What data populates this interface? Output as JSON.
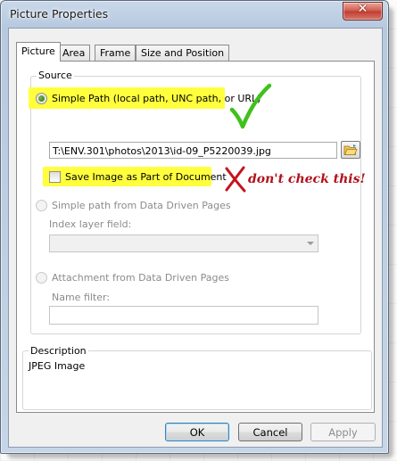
{
  "window": {
    "title": "Picture Properties",
    "close_glyph": "✕"
  },
  "tabs": [
    {
      "label": "Picture",
      "active": true
    },
    {
      "label": "Area",
      "active": false
    },
    {
      "label": "Frame",
      "active": false
    },
    {
      "label": "Size and Position",
      "active": false
    }
  ],
  "source": {
    "group_label": "Source",
    "simple_path_label": "Simple Path (local path, UNC path, or URL)",
    "path_value": "T:\\ENV.301\\photos\\2013\\id-09_P5220039.jpg",
    "save_image_label": "Save Image as Part of Document",
    "ddp_path_label": "Simple path from Data Driven Pages",
    "index_layer_label": "Index layer field:",
    "attachment_label": "Attachment from Data Driven Pages",
    "name_filter_label": "Name filter:"
  },
  "description": {
    "group_label": "Description",
    "text": "JPEG Image"
  },
  "buttons": {
    "ok": "OK",
    "cancel": "Cancel",
    "apply": "Apply"
  },
  "annotations": {
    "warning_text": "don't check this!",
    "checkmark_color": "#3fc11b",
    "cross_color": "#c4141b"
  },
  "colors": {
    "highlight": "#ffff3d"
  }
}
